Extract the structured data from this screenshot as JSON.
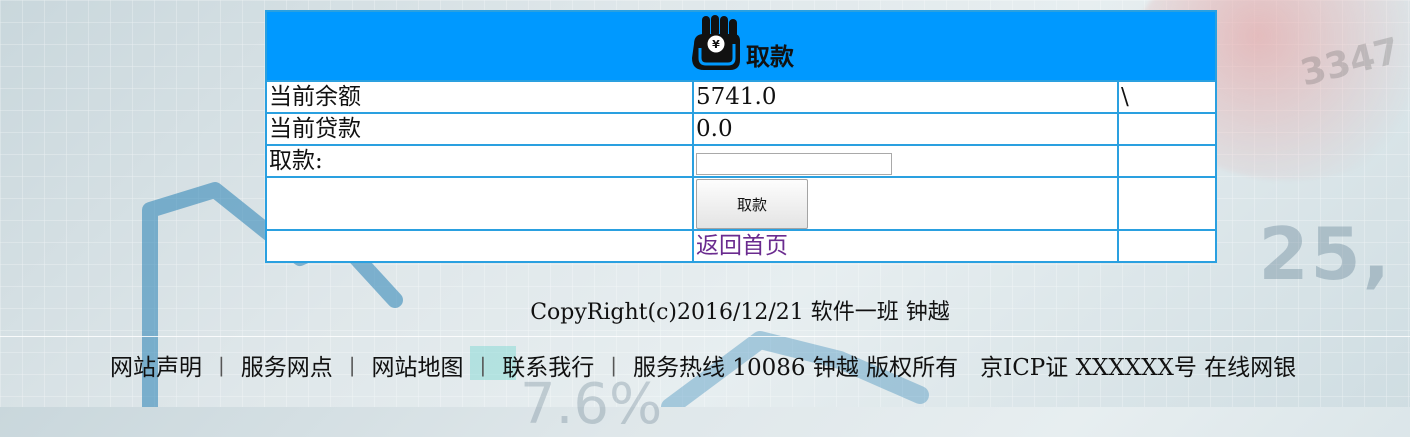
{
  "header": {
    "title": "取款",
    "icon": "wallet-yen-icon"
  },
  "rows": [
    {
      "label": "当前余额",
      "value": "5741.0",
      "extra": "\\"
    },
    {
      "label": "当前贷款",
      "value": "0.0",
      "extra": ""
    }
  ],
  "withdraw": {
    "label": "取款:",
    "input_value": "",
    "button_label": "取款"
  },
  "home_link": "返回首页",
  "copyright": "CopyRight(c)2016/12/21 软件一班 钟越",
  "footer": {
    "links": [
      "网站声明",
      "服务网点",
      "网站地图",
      "联系我行"
    ],
    "hotline": "服务热线 10086 钟越 版权所有",
    "icp": "京ICP证 XXXXXX号 在线网银"
  },
  "background": {
    "number_large": "25,",
    "number_small": "3347",
    "percent": "7.6%"
  },
  "colors": {
    "header_bg": "#0099ff",
    "table_border": "#2aa0e0",
    "link": "#6a2b8f"
  }
}
